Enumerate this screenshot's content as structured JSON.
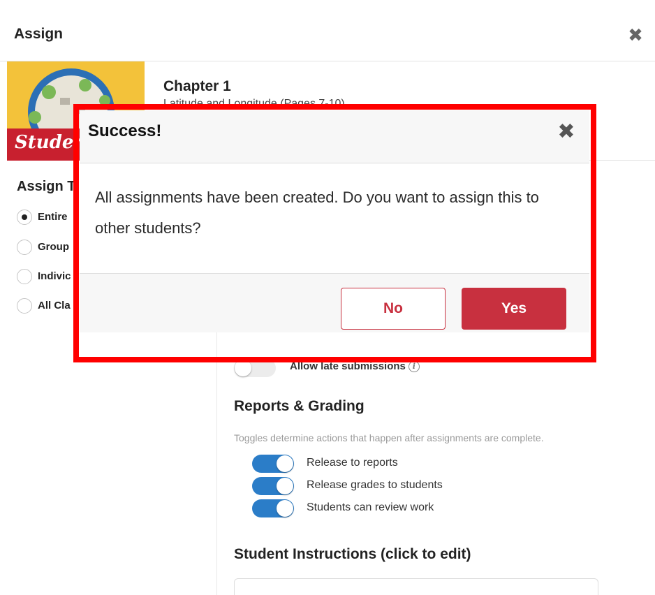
{
  "header": {
    "title": "Assign",
    "close_icon": "close-icon"
  },
  "content": {
    "thumbnail_label": "Studen",
    "title": "Chapter 1",
    "subtitle": "Latitude and Longitude (Pages 7-10)"
  },
  "assign_to": {
    "title": "Assign T",
    "options": [
      {
        "label": "Entire",
        "selected": true
      },
      {
        "label": "Group",
        "selected": false
      },
      {
        "label": "Indivic",
        "selected": false
      },
      {
        "label": "All Cla",
        "selected": false
      }
    ]
  },
  "settings": {
    "late_submissions_label": "Allow late submissions",
    "late_submissions_on": false,
    "reports_title": "Reports & Grading",
    "reports_desc": "Toggles determine actions that happen after assignments are complete.",
    "toggles": [
      {
        "label": "Release to reports",
        "on": true
      },
      {
        "label": "Release grades to students",
        "on": true
      },
      {
        "label": "Students can review work",
        "on": true
      }
    ],
    "instructions_title": "Student Instructions (click to edit)"
  },
  "modal": {
    "title": "Success!",
    "message": "All assignments have been created. Do you want to assign this to other students?",
    "no_label": "No",
    "yes_label": "Yes"
  },
  "colors": {
    "accent_red": "#c8303f",
    "toggle_blue": "#2b7dc8",
    "highlight_red": "#ff0000",
    "thumbnail_yellow": "#f3c23a"
  }
}
